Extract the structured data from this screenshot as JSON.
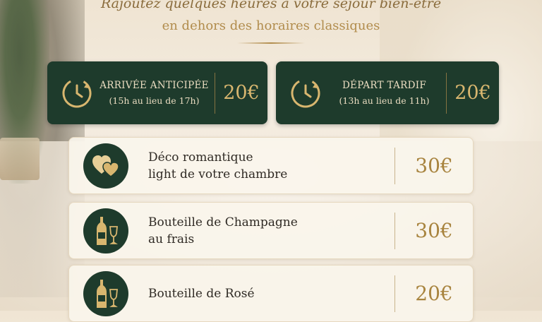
{
  "header": {
    "line1": "Rajoutez quelques heures à votre séjour bien-être",
    "line2": "en dehors des horaires classiques"
  },
  "cards": [
    {
      "title": "ARRIVÉE ANTICIPÉE",
      "subtitle": "(15h au lieu de 17h)",
      "price": "20€",
      "icon": "clock-icon"
    },
    {
      "title": "DÉPART TARDIF",
      "subtitle": "(13h au lieu de 11h)",
      "price": "20€",
      "icon": "clock-icon"
    }
  ],
  "options": [
    {
      "line1": "Déco romantique",
      "line2": "light de votre chambre",
      "price": "30€",
      "icon": "hearts-icon"
    },
    {
      "line1": "Bouteille de Champagne",
      "line2": "au frais",
      "price": "30€",
      "icon": "bottle-glass-icon"
    },
    {
      "line1": "Bouteille de Rosé",
      "line2": "",
      "price": "20€",
      "icon": "bottle-glass-icon"
    }
  ],
  "colors": {
    "dark_green": "#1e3b2c",
    "gold": "#b18c4c",
    "cream": "#faf5ec"
  }
}
